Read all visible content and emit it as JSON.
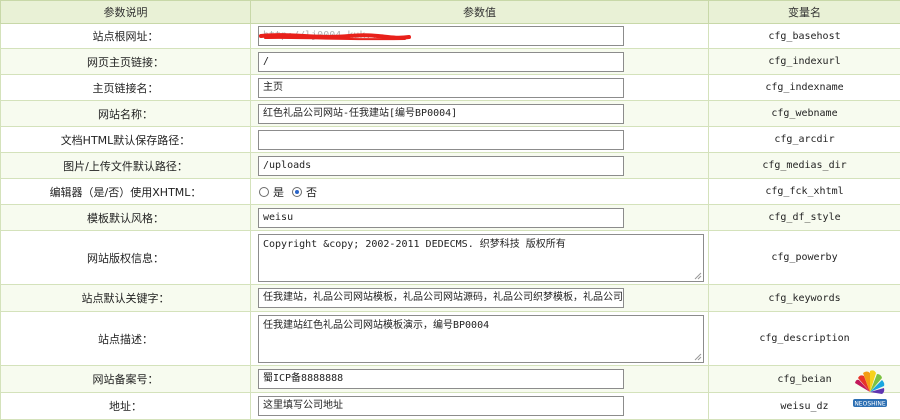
{
  "header": {
    "col_desc": "参数说明",
    "col_value": "参数值",
    "col_var": "变量名"
  },
  "rows": [
    {
      "label": "站点根网址：",
      "value": "http://lj0004.kuk...",
      "var": "cfg_basehost"
    },
    {
      "label": "网页主页链接：",
      "value": "/",
      "var": "cfg_indexurl"
    },
    {
      "label": "主页链接名：",
      "value": "主页",
      "var": "cfg_indexname"
    },
    {
      "label": "网站名称：",
      "value": "红色礼品公司网站-任我建站[编号BP0004]",
      "var": "cfg_webname"
    },
    {
      "label": "文档HTML默认保存路径：",
      "value": "",
      "var": "cfg_arcdir"
    },
    {
      "label": "图片/上传文件默认路径：",
      "value": "/uploads",
      "var": "cfg_medias_dir"
    },
    {
      "label": "编辑器（是/否）使用XHTML：",
      "value": "",
      "var": "cfg_fck_xhtml",
      "option_yes": "是",
      "option_no": "否",
      "selected": "否"
    },
    {
      "label": "模板默认风格：",
      "value": "weisu",
      "var": "cfg_df_style"
    },
    {
      "label": "网站版权信息：",
      "value": "Copyright &copy; 2002-2011 DEDECMS. 织梦科技 版权所有",
      "var": "cfg_powerby"
    },
    {
      "label": "站点默认关键字：",
      "value": "任我建站，礼品公司网站模板，礼品公司网站源码，礼品公司织梦模板，礼品公司de",
      "var": "cfg_keywords"
    },
    {
      "label": "站点描述：",
      "value": "任我建站红色礼品公司网站模板演示，编号BP0004",
      "var": "cfg_description"
    },
    {
      "label": "网站备案号：",
      "value": "蜀ICP备8888888",
      "var": "cfg_beian"
    },
    {
      "label": "地址：",
      "value": "这里填写公司地址",
      "var": "weisu_dz"
    }
  ],
  "colors": {
    "header_bg": "#e9f1d6",
    "border": "#d4e2bb",
    "redaction": "#e8201a"
  },
  "logo_text": "NEOSHINE"
}
